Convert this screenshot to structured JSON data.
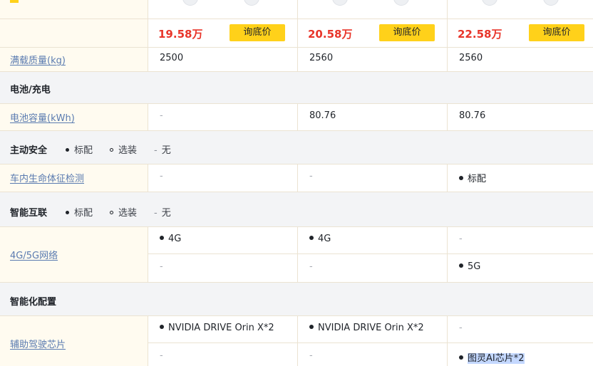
{
  "price_row": {
    "cars": [
      {
        "price": "19.58万",
        "button": "询底价"
      },
      {
        "price": "20.58万",
        "button": "询底价"
      },
      {
        "price": "22.58万",
        "button": "询底价"
      }
    ]
  },
  "spec_full_load": {
    "label": "满载质量(kg)",
    "values": [
      "2500",
      "2560",
      "2560"
    ]
  },
  "section_battery": {
    "title": "电池/充电"
  },
  "spec_battery": {
    "label": "电池容量(kWh)",
    "values": [
      "-",
      "80.76",
      "80.76"
    ]
  },
  "section_active_safety": {
    "title": "主动安全"
  },
  "legend": {
    "standard": "标配",
    "optional": "选装",
    "none": "无",
    "dash": "-"
  },
  "spec_life_detect": {
    "label": "车内生命体征检测",
    "values": [
      "-",
      "-",
      "标配"
    ]
  },
  "section_connectivity": {
    "title": "智能互联"
  },
  "spec_network": {
    "label": "4G/5G网络",
    "rows": [
      [
        "4G",
        "4G",
        "-"
      ],
      [
        "-",
        "-",
        "5G"
      ]
    ]
  },
  "section_intelligence": {
    "title": "智能化配置"
  },
  "spec_chip": {
    "label": "辅助驾驶芯片",
    "rows": [
      [
        "NVIDIA DRIVE Orin X*2",
        "NVIDIA DRIVE Orin X*2",
        "-"
      ],
      [
        "-",
        "-",
        "图灵AI芯片*2"
      ]
    ]
  }
}
